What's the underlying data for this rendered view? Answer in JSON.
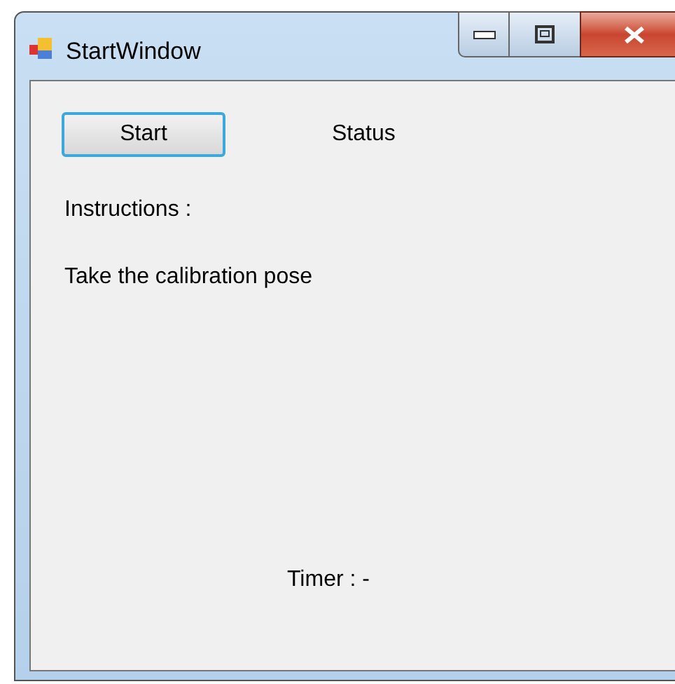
{
  "window": {
    "title": "StartWindow"
  },
  "start_button": {
    "label": "Start",
    "focused": true
  },
  "status": "Status",
  "instructions_label": "Instructions :",
  "instruction": "Take the calibration pose",
  "timer": "Timer : -"
}
